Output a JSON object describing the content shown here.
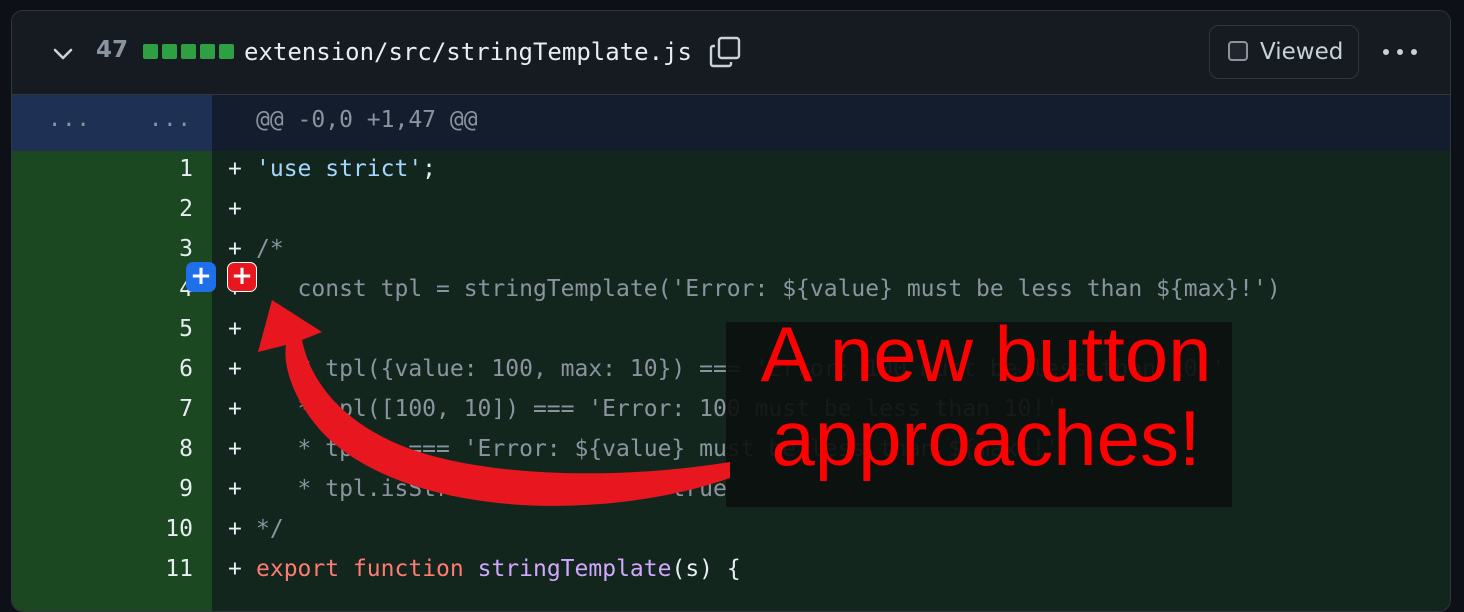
{
  "file": {
    "lines_changed": "47",
    "path": "extension/src/stringTemplate.js",
    "viewed_label": "Viewed",
    "viewed_checked": false
  },
  "hunk": {
    "expand_left": "...",
    "expand_right": "...",
    "header": "@@ -0,0 +1,47 @@"
  },
  "diff_lines": [
    {
      "number": "1",
      "sign": "+"
    },
    {
      "number": "2",
      "sign": "+"
    },
    {
      "number": "3",
      "sign": "+"
    },
    {
      "number": "4",
      "sign": "+"
    },
    {
      "number": "5",
      "sign": "+"
    },
    {
      "number": "6",
      "sign": "+"
    },
    {
      "number": "7",
      "sign": "+"
    },
    {
      "number": "8",
      "sign": "+"
    },
    {
      "number": "9",
      "sign": "+"
    },
    {
      "number": "10",
      "sign": "+"
    },
    {
      "number": "11",
      "sign": "+"
    }
  ],
  "code": {
    "l1": "'use strict'",
    "l1_end": ";",
    "l3": "/*",
    "l4": "   const tpl = stringTemplate('Error: ${value} must be less than ${max}!')",
    "l6": "   * tpl({value: 100, max: 10}) === 'Error: 100 must be less than 10!'",
    "l7": "   * tpl([100, 10]) === 'Error: 100 must be less than 10!'",
    "l8": "   * tpl() === 'Error: ${value} must be less than ${max}!'",
    "l9": "   * tpl.isStringTemplate === true",
    "l10": "*/",
    "l11_kw1": "export",
    "l11_kw2": "function",
    "l11_fn": "stringTemplate",
    "l11_rest": "(s) {"
  },
  "buttons": {
    "blue_plus": "+",
    "red_plus": "+"
  },
  "annotation": {
    "line1": "A new button",
    "line2": "approaches!"
  },
  "colors": {
    "diffstat_added": "#2ea043",
    "annotation": "#ff0000",
    "blue_button": "#1f6feb",
    "red_button": "#e8161e"
  }
}
